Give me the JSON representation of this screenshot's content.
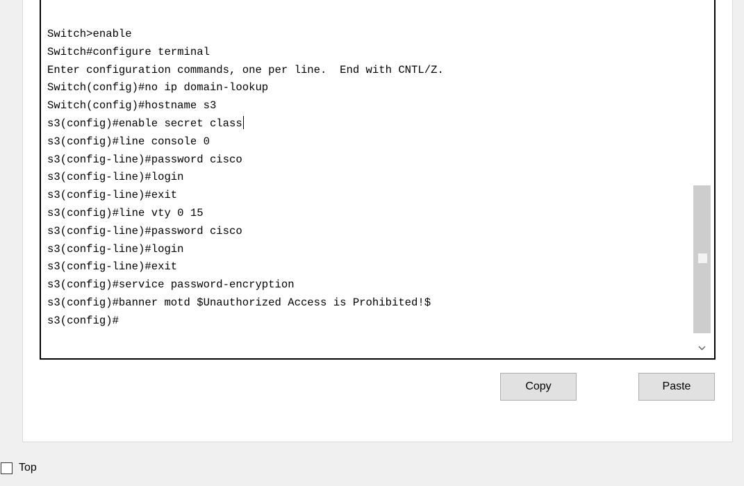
{
  "terminal": {
    "lines": [
      "Switch>enable",
      "Switch#configure terminal",
      "Enter configuration commands, one per line.  End with CNTL/Z.",
      "Switch(config)#no ip domain-lookup",
      "Switch(config)#hostname s3",
      "s3(config)#enable secret class",
      "s3(config)#line console 0",
      "s3(config-line)#password cisco",
      "s3(config-line)#login",
      "s3(config-line)#exit",
      "s3(config)#line vty 0 15",
      "s3(config-line)#password cisco",
      "s3(config-line)#login",
      "s3(config-line)#exit",
      "s3(config)#service password-encryption",
      "s3(config)#banner motd $Unauthorized Access is Prohibited!$",
      "s3(config)#"
    ],
    "caret_line_index": 5
  },
  "buttons": {
    "copy_label": "Copy",
    "paste_label": "Paste"
  },
  "top_checkbox": {
    "label": "Top",
    "checked": false
  },
  "icons": {
    "scroll_down": "chevron-down-icon"
  },
  "colors": {
    "background": "#f0f0f0",
    "terminal_bg": "#ffffff",
    "button_bg": "#e1e1e1",
    "scroll_thumb": "#cdcdcd"
  }
}
